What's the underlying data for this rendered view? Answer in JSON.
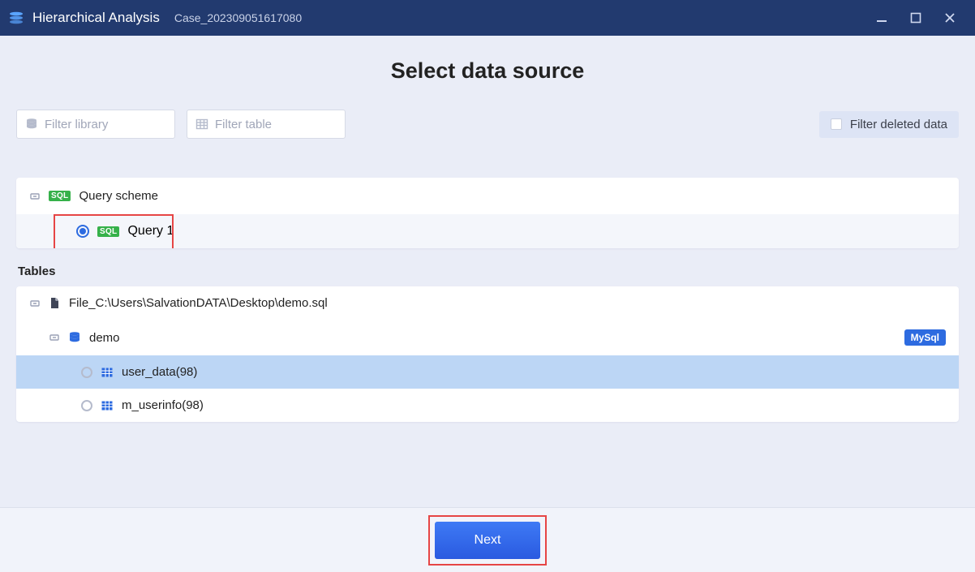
{
  "titlebar": {
    "app_title": "Hierarchical Analysis",
    "case_name": "Case_202309051617080"
  },
  "page": {
    "title": "Select data source"
  },
  "filters": {
    "library_placeholder": "Filter library",
    "table_placeholder": "Filter table",
    "deleted_label": "Filter deleted data"
  },
  "scheme": {
    "header": "Query scheme",
    "sql_badge": "SQL",
    "items": [
      {
        "label": "Query 1",
        "selected": true
      }
    ]
  },
  "tables": {
    "section_label": "Tables",
    "file_label": "File_C:\\Users\\SalvationDATA\\Desktop\\demo.sql",
    "db_label": "demo",
    "db_badge": "MySql",
    "rows": [
      {
        "label": "user_data(98)",
        "selected": true
      },
      {
        "label": "m_userinfo(98)",
        "selected": false
      }
    ]
  },
  "footer": {
    "next_label": "Next"
  }
}
